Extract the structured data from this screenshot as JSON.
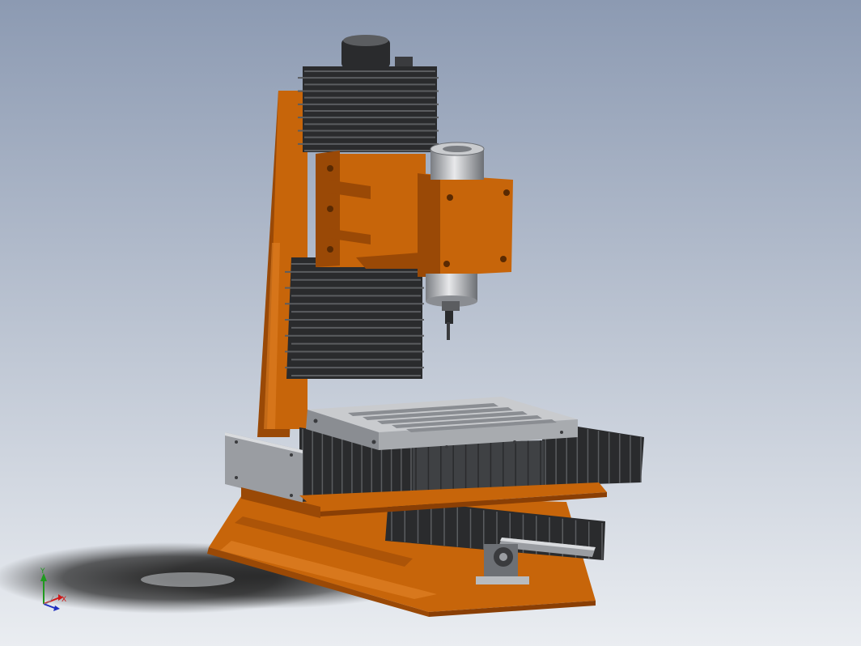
{
  "viewport": {
    "background_top": "#8c9ab2",
    "background_bottom": "#eaedf1"
  },
  "model": {
    "colors": {
      "frame": "#c7650a",
      "frame_dark": "#9a4906",
      "frame_light": "#e08025",
      "bellows": "#2a2b2d",
      "bellows_light": "#5b5d60",
      "metal": "#9a9da2",
      "metal_light": "#d9dbde"
    }
  },
  "triad": {
    "y_label": "Y",
    "x_label": "X",
    "y_color": "#1f9a1f",
    "x_color": "#d01818",
    "z_color": "#1f2fc0"
  }
}
